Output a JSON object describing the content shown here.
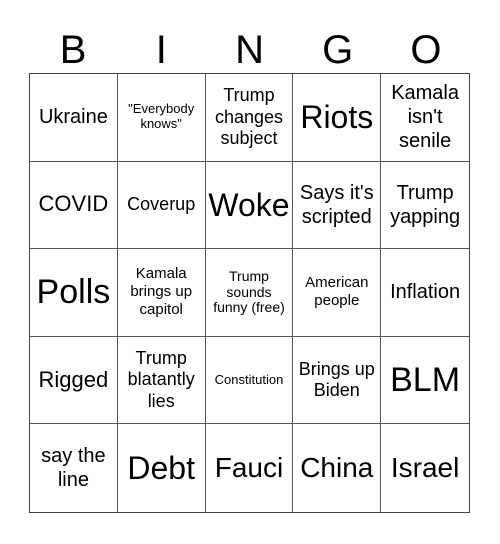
{
  "header": {
    "letters": [
      "B",
      "I",
      "N",
      "G",
      "O"
    ]
  },
  "cells": [
    "Ukraine",
    "\"Everybody knows\"",
    "Trump changes subject",
    "Riots",
    "Kamala isn't senile",
    "COVID",
    "Coverup",
    "Woke",
    "Says it's scripted",
    "Trump yapping",
    "Polls",
    "Kamala brings up capitol",
    "Trump sounds funny (free)",
    "American people",
    "Inflation",
    "Rigged",
    "Trump blatantly lies",
    "Constitution",
    "Brings up Biden",
    "BLM",
    "say the line",
    "Debt",
    "Fauci",
    "China",
    "Israel"
  ]
}
